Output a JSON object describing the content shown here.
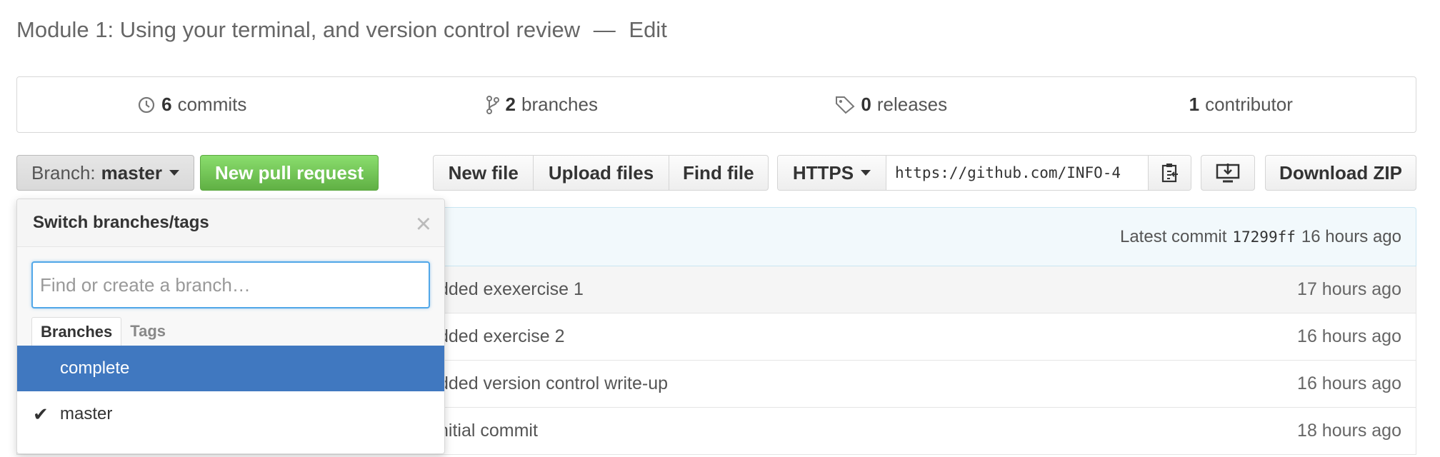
{
  "repo": {
    "description": "Module 1: Using your terminal, and version control review",
    "dash": "—",
    "edit_label": "Edit"
  },
  "stats": [
    {
      "icon": "history-icon",
      "count": "6",
      "label": "commits"
    },
    {
      "icon": "branch-icon",
      "count": "2",
      "label": "branches"
    },
    {
      "icon": "tag-icon",
      "count": "0",
      "label": "releases"
    },
    {
      "icon": "",
      "count": "1",
      "label": "contributor"
    }
  ],
  "toolbar": {
    "branch_prefix": "Branch:",
    "branch_name": "master",
    "new_pr_label": "New pull request",
    "new_file_label": "New file",
    "upload_files_label": "Upload files",
    "find_file_label": "Find file",
    "protocol_label": "HTTPS",
    "clone_url": "https://github.com/INFO-4",
    "download_zip_label": "Download ZIP"
  },
  "commit_tease": {
    "prefix": "Latest commit",
    "sha": "17299ff",
    "age": "16 hours ago"
  },
  "files": [
    {
      "message": "dded exexercise 1",
      "age": "17 hours ago"
    },
    {
      "message": "dded exercise 2",
      "age": "16 hours ago"
    },
    {
      "message": "dded version control write-up",
      "age": "16 hours ago"
    },
    {
      "message": "nitial commit",
      "age": "18 hours ago"
    }
  ],
  "dropdown": {
    "title": "Switch branches/tags",
    "close": "×",
    "filter_placeholder": "Find or create a branch…",
    "tabs": [
      "Branches",
      "Tags"
    ],
    "items": [
      {
        "name": "complete",
        "selected": true,
        "checked": false
      },
      {
        "name": "master",
        "selected": false,
        "checked": true
      }
    ]
  },
  "colors": {
    "accent": "#4078c0",
    "pr_green": "#6cc644",
    "focus_blue": "#51a7e8"
  }
}
